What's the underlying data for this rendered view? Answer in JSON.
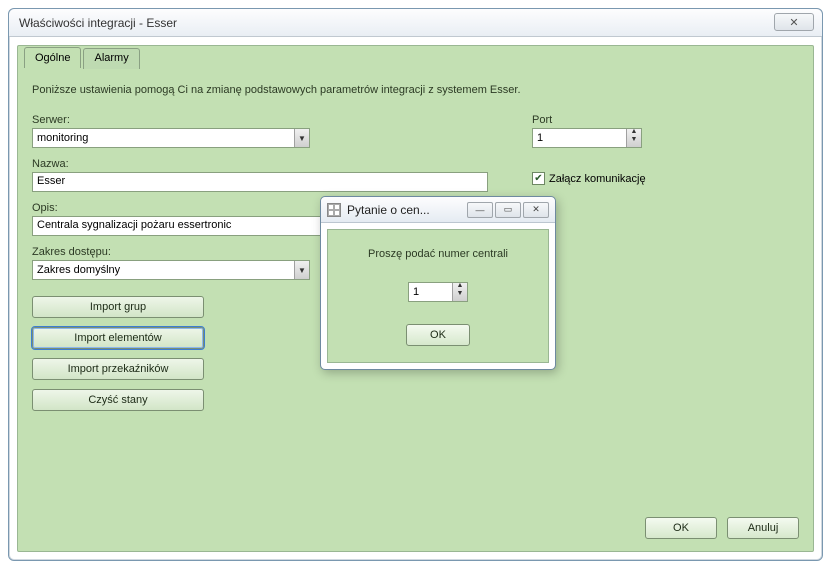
{
  "window": {
    "title": "Właściwości integracji  - Esser",
    "close_glyph": "✕"
  },
  "tabs": [
    {
      "label": "Ogólne",
      "active": true
    },
    {
      "label": "Alarmy",
      "active": false
    }
  ],
  "intro": "Poniższe ustawienia pomogą Ci na zmianę podstawowych parametrów integracji z systemem Esser.",
  "fields": {
    "server_label": "Serwer:",
    "server_value": "monitoring",
    "name_label": "Nazwa:",
    "name_value": "Esser",
    "desc_label": "Opis:",
    "desc_value": "Centrala sygnalizacji pożaru essertronic",
    "scope_label": "Zakres dostępu:",
    "scope_value": "Zakres domyślny",
    "port_label": "Port",
    "port_value": "1",
    "comm_checkbox_label": "Załącz komunikację",
    "comm_checked": true
  },
  "buttons": {
    "import_groups": "Import grup",
    "import_elements": "Import elementów",
    "import_relays": "Import przekaźników",
    "clear_states": "Czyść stany",
    "ok": "OK",
    "cancel": "Anuluj"
  },
  "modal": {
    "title": "Pytanie o cen...",
    "prompt": "Proszę podać numer centrali",
    "value": "1",
    "ok": "OK",
    "min_glyph": "—",
    "max_glyph": "▭",
    "close_glyph": "✕"
  }
}
